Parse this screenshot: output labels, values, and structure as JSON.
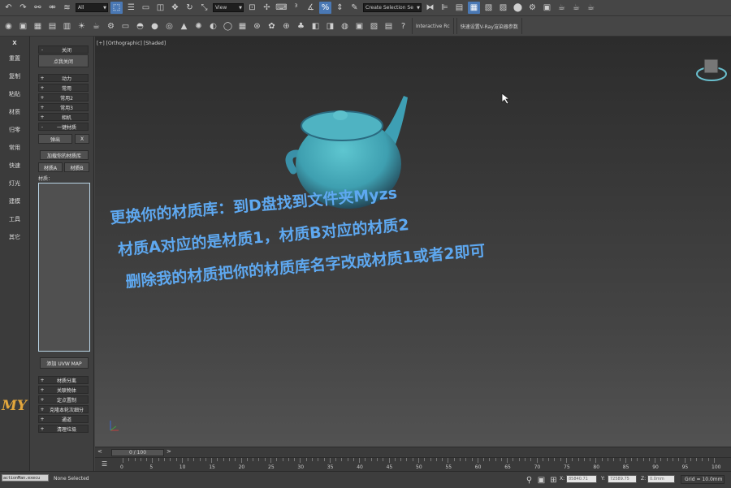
{
  "toolbar": {
    "selection_filter": "All",
    "ref_coord": "View",
    "named_selection_placeholder": "Create Selection Se",
    "interactive_label": "Interactive Rc",
    "vray_label": "快速设置V-Ray渲染器参数"
  },
  "left_column": {
    "close_symbol": "X",
    "items": [
      "重置",
      "复制",
      "粘贴",
      "材质",
      "归零",
      "常用",
      "快速",
      "灯光",
      "建模",
      "工具",
      "其它"
    ],
    "logo": "MY"
  },
  "panel": {
    "close_header": "关闭",
    "expand_all": "点我关闭",
    "rollouts_top": [
      "动力",
      "常用",
      "常用2",
      "常用3",
      "相机"
    ],
    "one_key_header": "一键材质",
    "popup_btn": "弹出",
    "close_btn": "X",
    "load_lib_btn": "加载你的材质库",
    "mat_a_btn": "材质A",
    "mat_b_btn": "材质B",
    "material_label": "材质：",
    "uvw_btn": "添加 UVW MAP",
    "rollouts_bottom": [
      "材质分离",
      "关联物体",
      "定点置制",
      "克隆本轮次细分",
      "通道",
      "清理垃圾"
    ]
  },
  "viewport": {
    "label": "[+] [Orthographic] [Shaded]",
    "annotations": [
      "更换你的材质库：到D盘找到文件夹Myzs",
      "材质A对应的是材质1，材质B对应的材质2",
      "删除我的材质把你的材质库名字改成材质1或者2即可"
    ]
  },
  "timeline": {
    "slider": "0 / 100",
    "ticks": [
      0,
      5,
      10,
      15,
      20,
      25,
      30,
      35,
      40,
      45,
      50,
      55,
      60,
      65,
      70,
      75,
      80,
      85,
      90,
      95,
      100
    ]
  },
  "status": {
    "mini_listener": "actionMan.execu",
    "message": "None Selected",
    "x_label": "X:",
    "x_value": "85840.71",
    "y_label": "Y:",
    "y_value": "72589.75",
    "z_label": "Z:",
    "z_value": "0.0mm",
    "grid": "Grid = 10.0mm"
  },
  "colors": {
    "accent": "#4a78b4",
    "annotation": "#5ea8f0",
    "logo": "#e2a63c",
    "teapot": "#3fa8b4"
  }
}
